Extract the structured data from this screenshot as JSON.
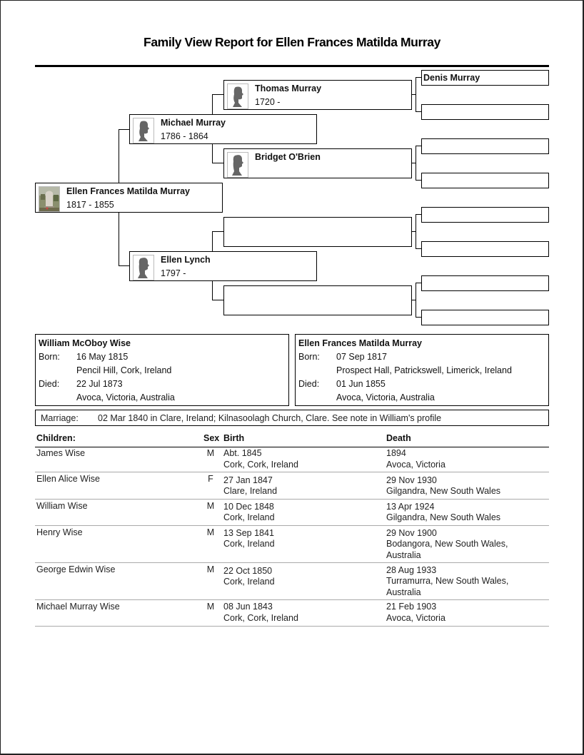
{
  "report": {
    "title": "Family View Report for Ellen Frances Matilda Murray"
  },
  "pedigree": {
    "root": {
      "name": "Ellen Frances Matilda Murray",
      "dates": "1817 - 1855",
      "photo": "gravestone-photo"
    },
    "father": {
      "name": "Michael Murray",
      "dates": "1786 - 1864",
      "photo": "male-silhouette-icon"
    },
    "mother": {
      "name": "Ellen Lynch",
      "dates": "1797 -",
      "photo": "female-silhouette-icon"
    },
    "paternal_grandfather": {
      "name": "Thomas Murray",
      "dates": "1720 -",
      "photo": "male-silhouette-icon"
    },
    "paternal_grandmother": {
      "name": "Bridget O'Brien",
      "dates": "",
      "photo": "female-silhouette-icon"
    },
    "maternal_grandfather": {
      "name": "",
      "dates": ""
    },
    "maternal_grandmother": {
      "name": "",
      "dates": ""
    },
    "great_grandparents": [
      {
        "name": "Denis Murray"
      },
      {
        "name": ""
      },
      {
        "name": ""
      },
      {
        "name": ""
      },
      {
        "name": ""
      },
      {
        "name": ""
      },
      {
        "name": ""
      },
      {
        "name": ""
      }
    ]
  },
  "husband": {
    "name": "William McOboy Wise",
    "born_label": "Born:",
    "born_date": "16 May 1815",
    "born_place": "Pencil Hill, Cork, Ireland",
    "died_label": "Died:",
    "died_date": "22 Jul 1873",
    "died_place": "Avoca, Victoria, Australia"
  },
  "wife": {
    "name": "Ellen Frances Matilda Murray",
    "born_label": "Born:",
    "born_date": "07 Sep 1817",
    "born_place": "Prospect Hall, Patrickswell, Limerick, Ireland",
    "died_label": "Died:",
    "died_date": "01 Jun 1855",
    "died_place": "Avoca, Victoria, Australia"
  },
  "marriage": {
    "label": "Marriage:",
    "value": "02 Mar 1840 in Clare, Ireland; Kilnasoolagh Church, Clare. See note in William's profile"
  },
  "children": {
    "headers": {
      "name": "Children:",
      "sex": "Sex",
      "birth": "Birth",
      "death": "Death"
    },
    "rows": [
      {
        "name": "James Wise",
        "sex": "M",
        "birth_date": "Abt. 1845",
        "birth_place": "Cork, Cork, Ireland",
        "death_date": "1894",
        "death_place": "Avoca, Victoria"
      },
      {
        "name": "Ellen Alice Wise",
        "sex": "F",
        "birth_date": "27 Jan 1847",
        "birth_place": "Clare, Ireland",
        "death_date": "29 Nov 1930",
        "death_place": "Gilgandra, New South Wales"
      },
      {
        "name": "William Wise",
        "sex": "M",
        "birth_date": "10 Dec 1848",
        "birth_place": "Cork, Ireland",
        "death_date": "13 Apr 1924",
        "death_place": "Gilgandra, New South Wales"
      },
      {
        "name": "Henry Wise",
        "sex": "M",
        "birth_date": "13 Sep 1841",
        "birth_place": "Cork, Ireland",
        "death_date": "29 Nov 1900",
        "death_place": "Bodangora, New South Wales, Australia"
      },
      {
        "name": "George Edwin Wise",
        "sex": "M",
        "birth_date": "22 Oct 1850",
        "birth_place": "Cork, Ireland",
        "death_date": "28 Aug 1933",
        "death_place": "Turramurra, New South Wales, Australia"
      },
      {
        "name": "Michael Murray Wise",
        "sex": "M",
        "birth_date": "08 Jun 1843",
        "birth_place": "Cork, Cork, Ireland",
        "death_date": "21 Feb 1903",
        "death_place": "Avoca, Victoria"
      }
    ]
  }
}
